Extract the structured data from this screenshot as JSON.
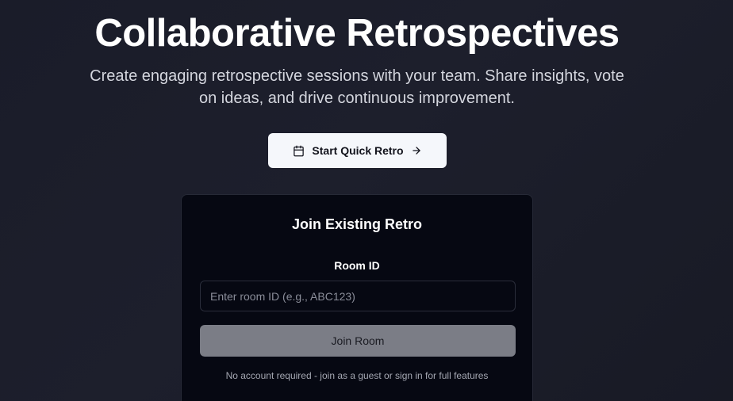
{
  "hero": {
    "title": "Collaborative Retrospectives",
    "subtitle": "Create engaging retrospective sessions with your team. Share insights, vote on ideas, and drive continuous improvement."
  },
  "quick_retro": {
    "label": "Start Quick Retro",
    "leading_icon": "calendar-icon",
    "trailing_icon": "arrow-right-icon"
  },
  "join_card": {
    "title": "Join Existing Retro",
    "room_label": "Room ID",
    "room_input": {
      "value": "",
      "placeholder": "Enter room ID (e.g., ABC123)"
    },
    "join_label": "Join Room",
    "note": "No account required - join as a guest or sign in for full features"
  },
  "colors": {
    "background": "#1c1e2b",
    "card_background": "#060812",
    "primary_button": "#f5f7fb",
    "disabled_button": "#7b7d86"
  }
}
